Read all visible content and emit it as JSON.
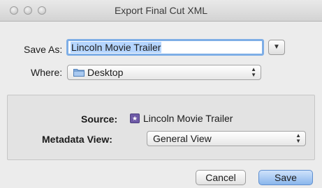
{
  "window": {
    "title": "Export Final Cut XML"
  },
  "form": {
    "save_as_label": "Save As:",
    "save_as_value": "Lincoln Movie Trailer",
    "where_label": "Where:",
    "where_value": "Desktop"
  },
  "options": {
    "source_label": "Source:",
    "source_value": "Lincoln Movie Trailer",
    "metadata_view_label": "Metadata View:",
    "metadata_view_value": "General View"
  },
  "buttons": {
    "cancel_label": "Cancel",
    "save_label": "Save"
  },
  "colors": {
    "focus_ring": "#7eaee6",
    "default_button": "#8ab6ec",
    "clip_icon": "#6e5aa6"
  }
}
